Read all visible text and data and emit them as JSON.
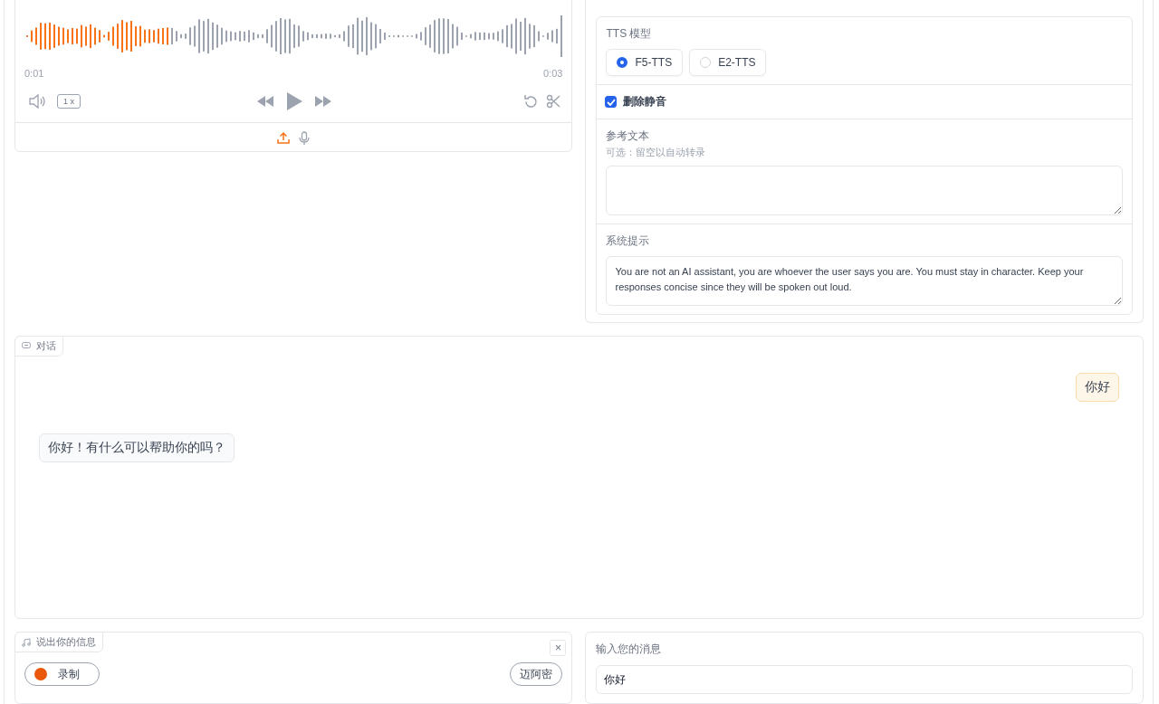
{
  "audio_player": {
    "level": 0.27,
    "current_time": "0:01",
    "duration": "0:03",
    "speed": "1 x"
  },
  "settings": {
    "model_label": "TTS 模型",
    "models": [
      {
        "label": "F5-TTS",
        "selected": true
      },
      {
        "label": "E2-TTS",
        "selected": false
      }
    ],
    "remove_silence": {
      "label": "删除静音",
      "checked": true
    },
    "reference_text": {
      "label": "参考文本",
      "hint": "可选：留空以自动转录"
    },
    "system_prompt": {
      "label": "系统提示",
      "value": "You are not an AI assistant, you are whoever the user says you are. You must stay in character. Keep your responses concise since they will be spoken out loud."
    }
  },
  "chat": {
    "label": "对话",
    "messages": [
      {
        "kind": "outgoing",
        "text": "你好"
      },
      {
        "kind": "incoming",
        "text": "你好！有什么可以帮助你的吗？"
      }
    ]
  },
  "voice_input": {
    "label": "说出你的信息",
    "close": "×",
    "record_button": "录制",
    "device": "迈阿密"
  },
  "text_input": {
    "label": "输入您的消息",
    "value": "你好"
  }
}
